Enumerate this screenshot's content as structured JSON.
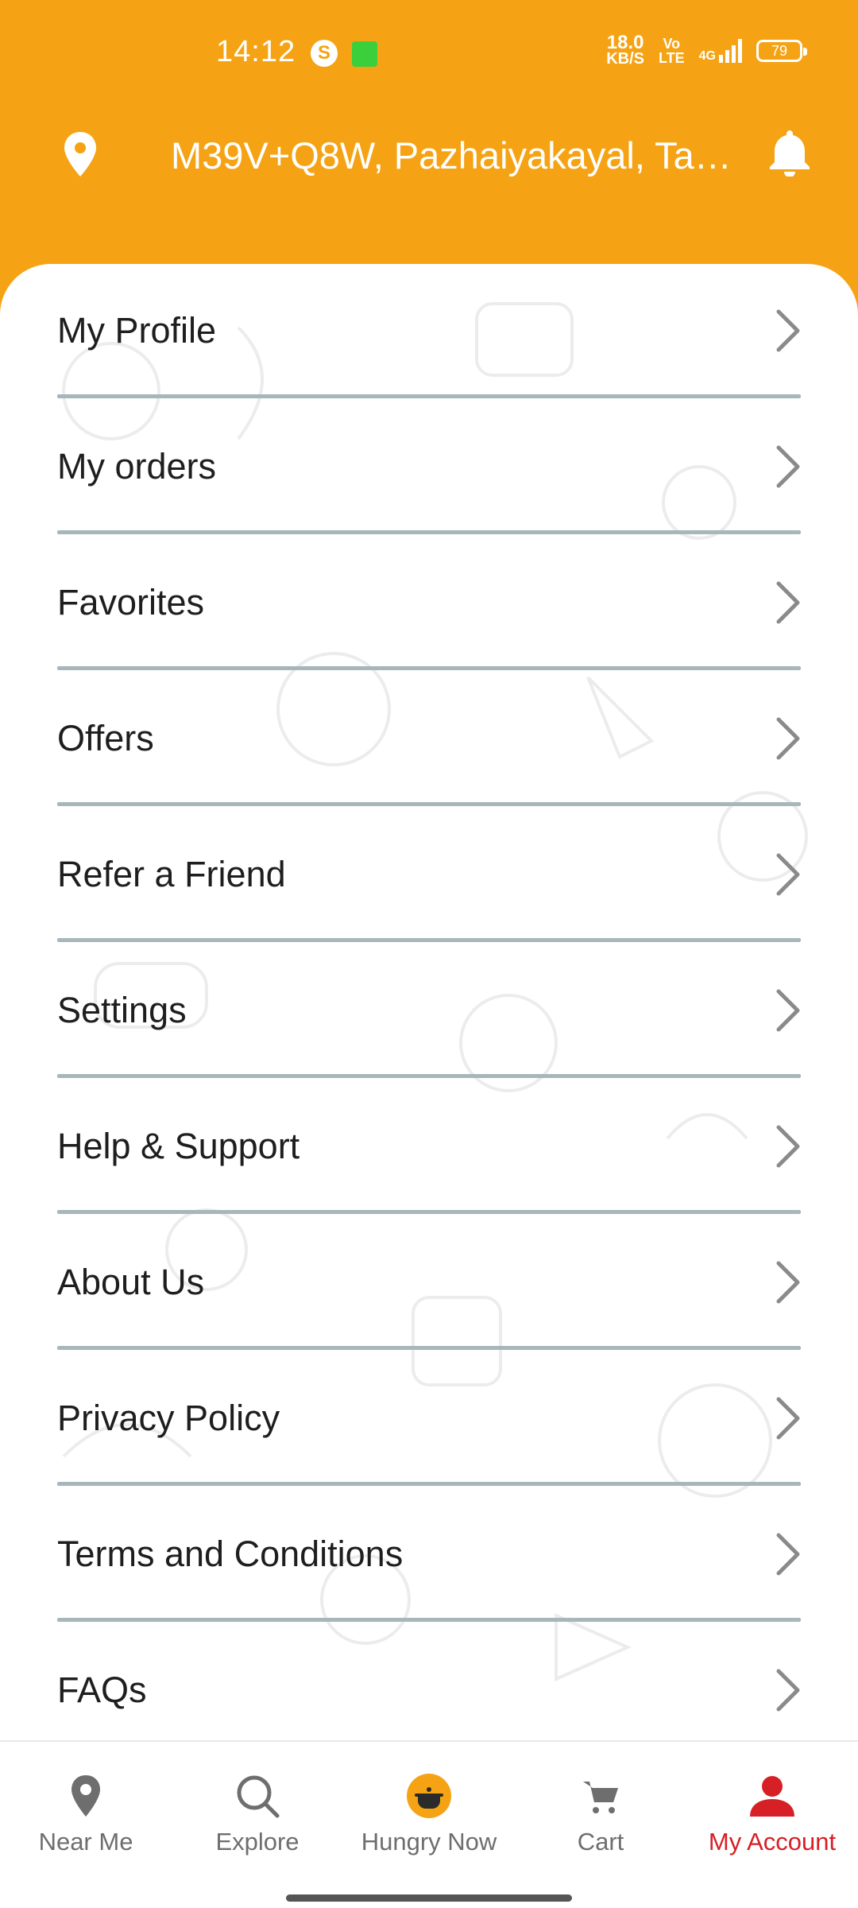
{
  "status_bar": {
    "time": "14:12",
    "net_speed_value": "18.0",
    "net_speed_unit": "KB/S",
    "volte_top": "Vo",
    "volte_bottom": "LTE",
    "network": "4G",
    "battery": "79",
    "app_icons": [
      "skype-icon",
      "messaging-app-icon"
    ]
  },
  "location": {
    "address": "M39V+Q8W, Pazhaiyakayal, Tami…",
    "pin_icon": "location-pin-icon",
    "bell_icon": "notification-bell-icon"
  },
  "menu": {
    "items": [
      {
        "label": "My Profile"
      },
      {
        "label": "My orders"
      },
      {
        "label": "Favorites"
      },
      {
        "label": "Offers"
      },
      {
        "label": "Refer a Friend"
      },
      {
        "label": "Settings"
      },
      {
        "label": "Help & Support"
      },
      {
        "label": "About Us"
      },
      {
        "label": "Privacy Policy"
      },
      {
        "label": "Terms and Conditions"
      },
      {
        "label": "FAQs"
      }
    ]
  },
  "bottom_nav": {
    "items": [
      {
        "label": "Near Me",
        "icon": "map-pin-icon"
      },
      {
        "label": "Explore",
        "icon": "search-icon"
      },
      {
        "label": "Hungry Now",
        "icon": "cooking-pot-icon"
      },
      {
        "label": "Cart",
        "icon": "cart-icon"
      },
      {
        "label": "My Account",
        "icon": "account-icon"
      }
    ],
    "active": "My Account"
  },
  "colors": {
    "header": "#f5a314",
    "active_nav": "#d62026",
    "inactive_nav": "#6e6e6e",
    "divider": "#a7b6ba"
  }
}
